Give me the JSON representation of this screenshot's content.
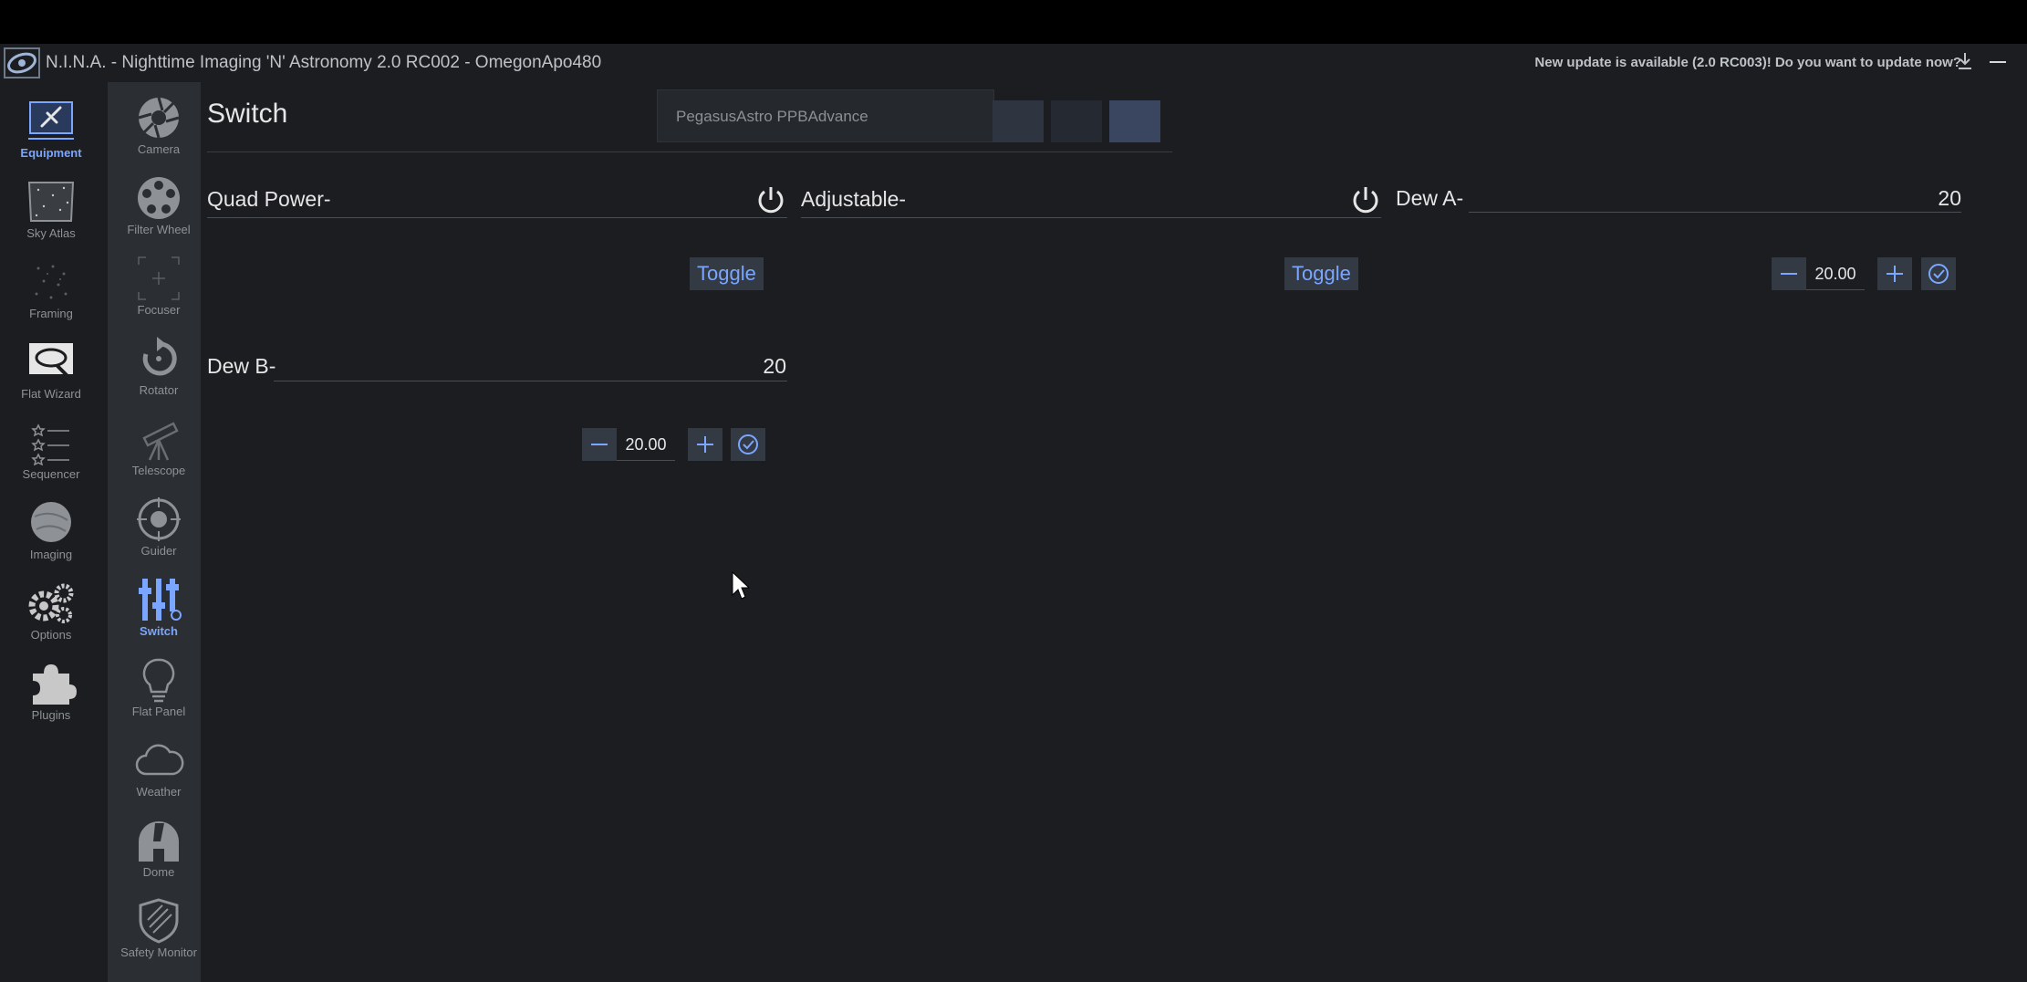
{
  "window": {
    "title": "N.I.N.A. - Nighttime Imaging 'N' Astronomy 2.0 RC002  -  OmegonApo480",
    "update_text": "New update is available (2.0 RC003)! Do you want to update now?"
  },
  "nav_primary": [
    {
      "label": "Equipment",
      "icon": "plug-icon",
      "active": true
    },
    {
      "label": "Sky Atlas",
      "icon": "sky-atlas-icon"
    },
    {
      "label": "Framing",
      "icon": "framing-icon"
    },
    {
      "label": "Flat Wizard",
      "icon": "flat-wizard-icon"
    },
    {
      "label": "Sequencer",
      "icon": "sequencer-icon"
    },
    {
      "label": "Imaging",
      "icon": "imaging-icon"
    },
    {
      "label": "Options",
      "icon": "gears-icon"
    },
    {
      "label": "Plugins",
      "icon": "puzzle-icon"
    }
  ],
  "nav_equipment": [
    {
      "label": "Camera",
      "icon": "camera-aperture-icon"
    },
    {
      "label": "Filter Wheel",
      "icon": "filter-wheel-icon"
    },
    {
      "label": "Focuser",
      "icon": "focuser-icon"
    },
    {
      "label": "Rotator",
      "icon": "rotator-icon"
    },
    {
      "label": "Telescope",
      "icon": "telescope-icon"
    },
    {
      "label": "Guider",
      "icon": "guider-icon"
    },
    {
      "label": "Switch",
      "icon": "switch-sliders-icon",
      "active": true
    },
    {
      "label": "Flat Panel",
      "icon": "lightbulb-icon"
    },
    {
      "label": "Weather",
      "icon": "cloud-icon"
    },
    {
      "label": "Dome",
      "icon": "dome-icon"
    },
    {
      "label": "Safety Monitor",
      "icon": "shield-icon"
    }
  ],
  "page": {
    "title": "Switch",
    "device": "PegasusAstro PPBAdvance"
  },
  "switches": {
    "quad_power": {
      "label": "Quad Power-",
      "button": "Toggle"
    },
    "adjustable": {
      "label": "Adjustable-",
      "button": "Toggle"
    },
    "dew_a": {
      "label": "Dew A-",
      "value": "20",
      "input": "20.00"
    },
    "dew_b": {
      "label": "Dew B-",
      "value": "20",
      "input": "20.00"
    }
  },
  "colors": {
    "accent": "#7aa6ff",
    "background": "#1b1d20",
    "sidebar": "#2b2e33"
  }
}
